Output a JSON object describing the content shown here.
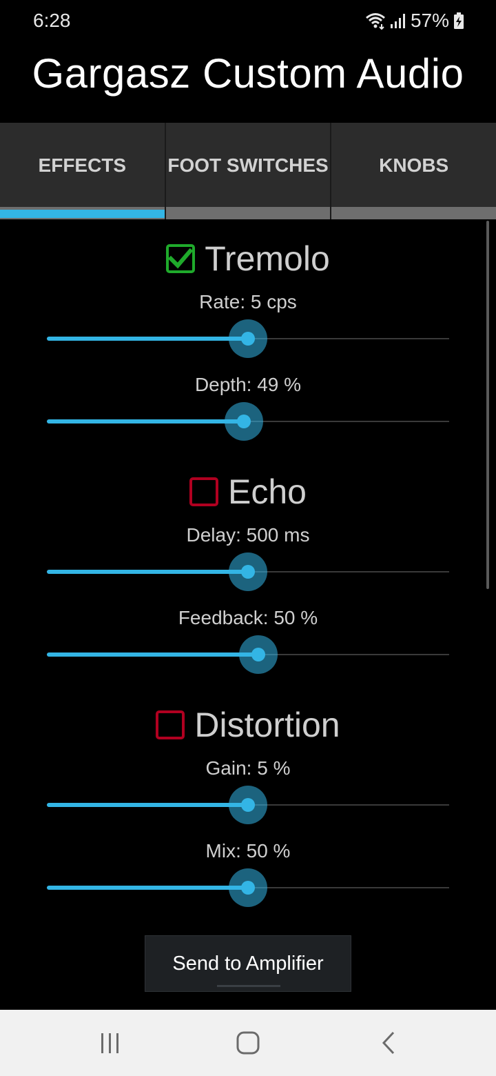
{
  "status_bar": {
    "time": "6:28",
    "battery": "57%"
  },
  "app": {
    "title": "Gargasz Custom Audio"
  },
  "tabs": [
    {
      "label": "EFFECTS",
      "active": true
    },
    {
      "label": "FOOT SWITCHES",
      "active": false
    },
    {
      "label": "KNOBS",
      "active": false
    }
  ],
  "effects": [
    {
      "name": "Tremolo",
      "enabled": true,
      "params": [
        {
          "label": "Rate: 5 cps",
          "level_fraction": 0.5
        },
        {
          "label": "Depth: 49 %",
          "level_fraction": 0.49
        }
      ]
    },
    {
      "name": "Echo",
      "enabled": false,
      "params": [
        {
          "label": "Delay: 500 ms",
          "level_fraction": 0.5
        },
        {
          "label": "Feedback: 50 %",
          "level_fraction": 0.525
        }
      ]
    },
    {
      "name": "Distortion",
      "enabled": false,
      "params": [
        {
          "label": "Gain: 5 %",
          "level_fraction": 0.5
        },
        {
          "label": "Mix: 50 %",
          "level_fraction": 0.5
        }
      ]
    }
  ],
  "actions": {
    "send_label": "Send to Amplifier"
  },
  "colors": {
    "accent": "#33b5e5",
    "checkbox_on": "#1faa2b",
    "checkbox_off": "#b00020",
    "tab_bar": "#2c2c2c"
  },
  "icons": {
    "status": [
      "wifi-icon",
      "signal-icon",
      "battery-charging-icon"
    ],
    "nav": [
      "recent-apps-icon",
      "home-icon",
      "back-icon"
    ]
  }
}
